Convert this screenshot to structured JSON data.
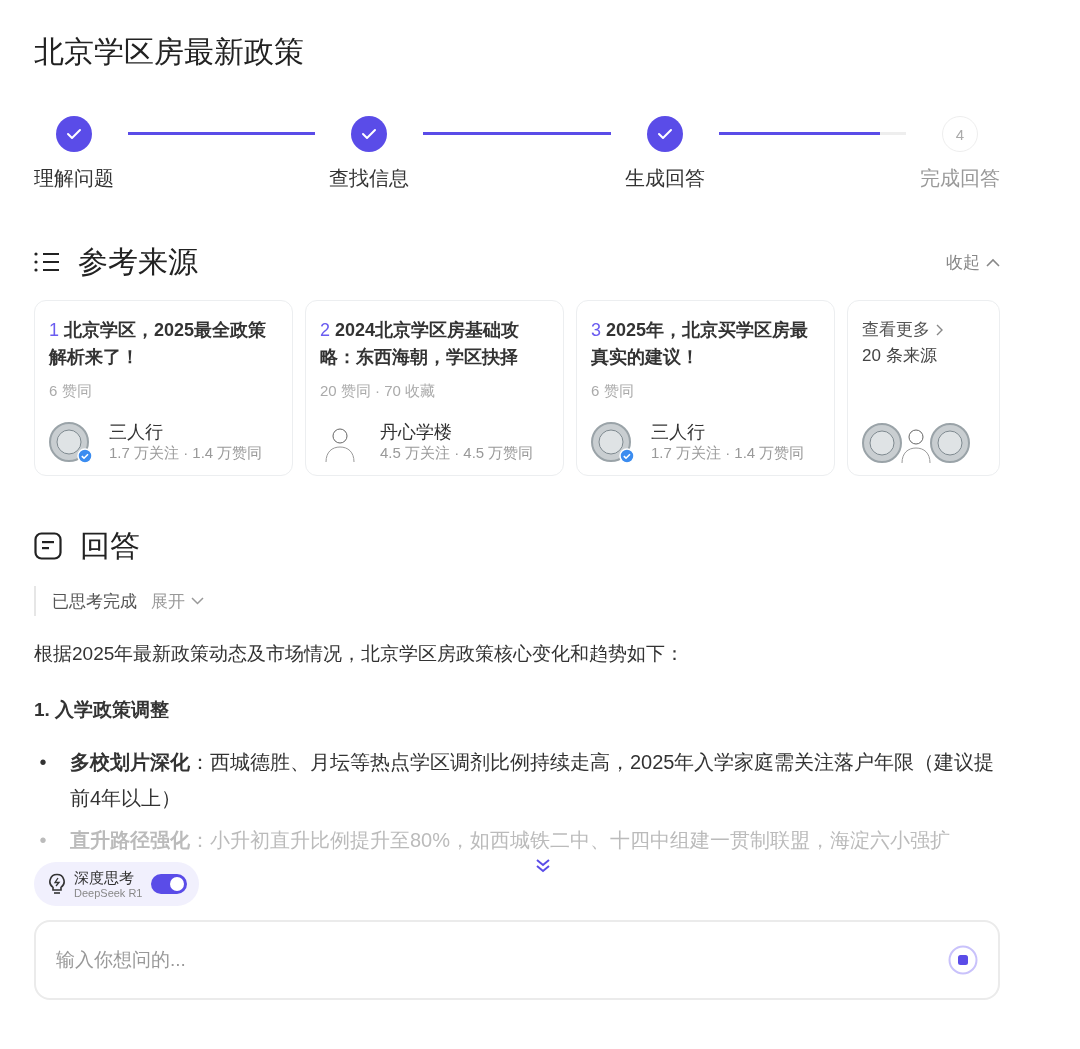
{
  "title": "北京学区房最新政策",
  "steps": [
    {
      "label": "理解问题",
      "done": true
    },
    {
      "label": "查找信息",
      "done": true
    },
    {
      "label": "生成回答",
      "done": true
    },
    {
      "label": "完成回答",
      "done": false,
      "number": "4"
    }
  ],
  "connectors": [
    {
      "level": 1
    },
    {
      "level": 1
    },
    {
      "level": 0.86
    }
  ],
  "sources": {
    "heading": "参考来源",
    "collapse": "收起",
    "cards": [
      {
        "index": "1",
        "title": "北京学区，2025最全政策解析来了！",
        "stats": "6 赞同",
        "author": "三人行",
        "author_stats": "1.7 万关注 · 1.4 万赞同",
        "verified": true
      },
      {
        "index": "2",
        "title": "2024北京学区房基础攻略：东西海朝，学区抉择",
        "stats": "20 赞同 · 70 收藏",
        "author": "丹心学楼",
        "author_stats": "4.5 万关注 · 4.5 万赞同",
        "verified": false
      },
      {
        "index": "3",
        "title": "2025年，北京买学区房最真实的建议！",
        "stats": "6 赞同",
        "author": "三人行",
        "author_stats": "1.7 万关注 · 1.4 万赞同",
        "verified": true
      }
    ],
    "more": {
      "label": "查看更多",
      "count": "20 条来源"
    }
  },
  "answer": {
    "heading": "回答",
    "thinking": "已思考完成",
    "expand": "展开",
    "intro": "根据2025年最新政策动态及市场情况，北京学区房政策核心变化和趋势如下：",
    "section": "1. 入学政策调整",
    "bullets": [
      {
        "marker": "•",
        "text": "**多校划片深化**：西城德胜、月坛等热点学区调剂比例持续走高，2025年入学家庭需关注落户年限（建议提前4年以上）"
      },
      {
        "marker": "•",
        "text": "**直升路径强化**：小升初直升比例提升至80%，如西城铁二中、十四中组建一贯制联盟，海淀六小强扩"
      }
    ]
  },
  "deep_think": {
    "label": "深度思考",
    "model": "DeepSeek R1",
    "on": true
  },
  "composer": {
    "placeholder": "输入你想问的..."
  }
}
